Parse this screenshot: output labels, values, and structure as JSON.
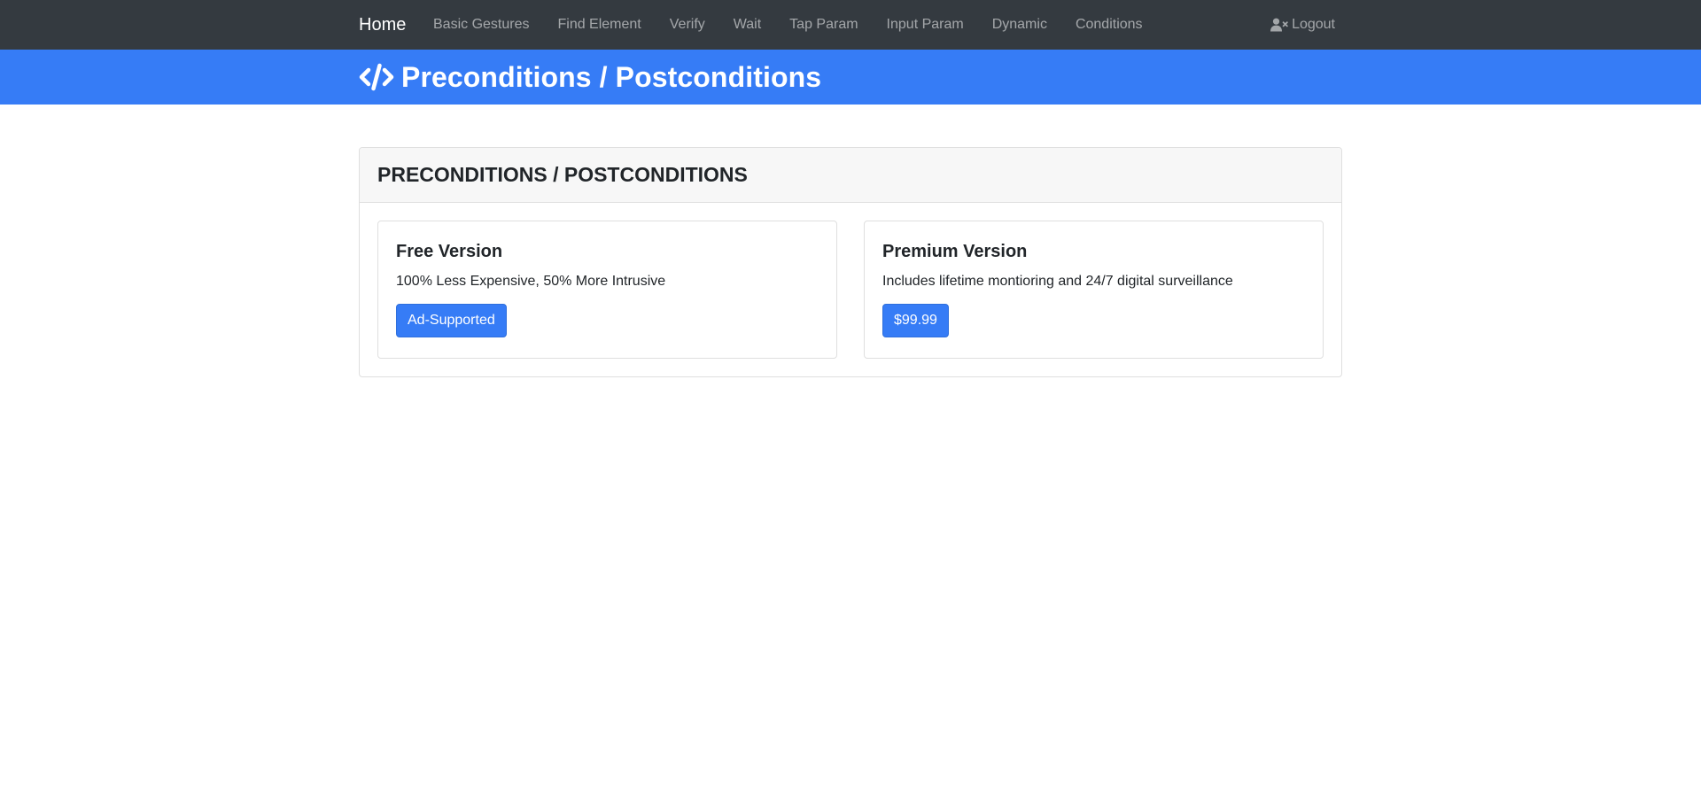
{
  "navbar": {
    "brand": "Home",
    "links": [
      {
        "label": "Basic Gestures"
      },
      {
        "label": "Find Element"
      },
      {
        "label": "Verify"
      },
      {
        "label": "Wait"
      },
      {
        "label": "Tap Param"
      },
      {
        "label": "Input Param"
      },
      {
        "label": "Dynamic"
      },
      {
        "label": "Conditions"
      }
    ],
    "logout_label": "Logout",
    "logout_icon": "user-times-icon",
    "background": "#343a40"
  },
  "header": {
    "title": "Preconditions / Postconditions",
    "icon": "code-icon",
    "background": "#367cf6"
  },
  "main": {
    "card_title": "PRECONDITIONS / POSTCONDITIONS",
    "options": [
      {
        "title": "Free Version",
        "description": "100% Less Expensive, 50% More Intrusive",
        "button_label": "Ad-Supported"
      },
      {
        "title": "Premium Version",
        "description": "Includes lifetime montioring and 24/7 digital surveillance",
        "button_label": "$99.99"
      }
    ]
  },
  "colors": {
    "primary": "#367cf6",
    "navbar": "#343a40",
    "card_header": "#f7f7f7",
    "border": "#dfdfdf"
  }
}
